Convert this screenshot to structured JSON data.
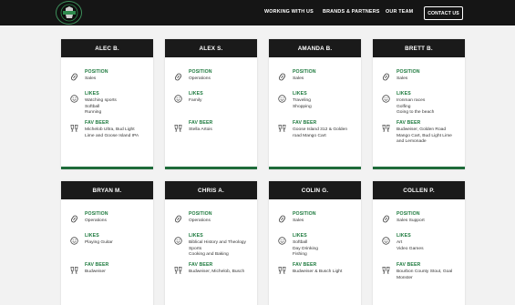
{
  "nav": {
    "links": [
      "WORKING WITH US",
      "BRANDS & PARTNERS",
      "OUR TEAM"
    ],
    "contact_label": "CONTACT US"
  },
  "labels": {
    "position": "POSITION",
    "likes": "LIKES",
    "fav_beer": "FAV BEER"
  },
  "team": [
    {
      "name": "ALEC B.",
      "position": [
        "Sales"
      ],
      "likes": [
        "Watching sports",
        "Softball",
        "Running"
      ],
      "fav_beer": [
        "Michelob Ultra, Bud Light",
        "Lime and Goose Island IPA"
      ]
    },
    {
      "name": "ALEX S.",
      "position": [
        "Operations"
      ],
      "likes": [
        "Family"
      ],
      "fav_beer": [
        "Stella Artois"
      ]
    },
    {
      "name": "AMANDA B.",
      "position": [
        "Sales"
      ],
      "likes": [
        "Traveling",
        "Shopping"
      ],
      "fav_beer": [
        "Goose Island 312 & Golden",
        "road Mango Cart"
      ]
    },
    {
      "name": "BRETT B.",
      "position": [
        "Sales"
      ],
      "likes": [
        "Ironman races",
        "Golfing",
        "Going to the beach"
      ],
      "fav_beer": [
        "Budweiser, Golden Road",
        "Mango Cart, Bud Light Lime",
        "and Lemonade"
      ]
    },
    {
      "name": "BRYAN M.",
      "position": [
        "Operations"
      ],
      "likes": [
        "Playing Guitar"
      ],
      "fav_beer": [
        "Budweiser"
      ]
    },
    {
      "name": "CHRIS A.",
      "position": [
        "Operations"
      ],
      "likes": [
        "Biblical History and Theology",
        "Sports",
        "Cooking and Baking"
      ],
      "fav_beer": [
        "Budweiser, Michelob, Busch"
      ]
    },
    {
      "name": "COLIN G.",
      "position": [
        "Sales"
      ],
      "likes": [
        "Softball",
        "Day Drinking",
        "Fishing"
      ],
      "fav_beer": [
        "Budweiser & Busch Light"
      ]
    },
    {
      "name": "COLLEN P.",
      "position": [
        "Sales Support"
      ],
      "likes": [
        "Art",
        "Video Games"
      ],
      "fav_beer": [
        "Bourbon County Stout, Goal",
        "Monster"
      ]
    }
  ]
}
